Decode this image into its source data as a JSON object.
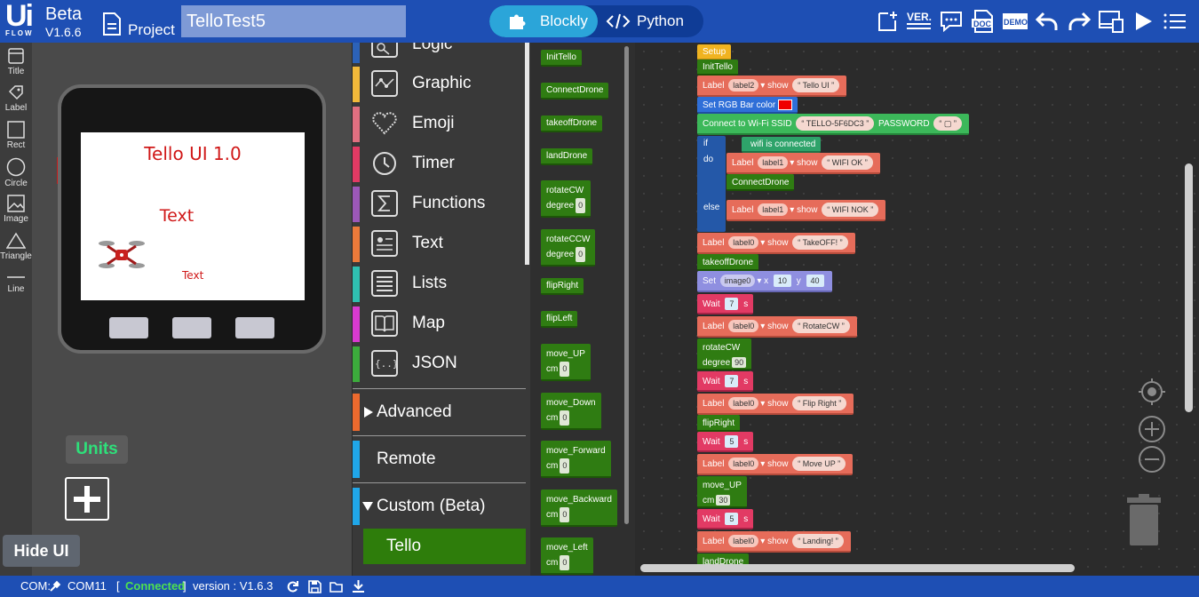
{
  "header": {
    "logo_ui": "Ui",
    "logo_flow": "FLOW",
    "beta": "Beta",
    "version": "V1.6.6",
    "project_label": "Project",
    "project_name": "TelloTest5",
    "mode_blockly": "Blockly",
    "mode_python": "Python",
    "icons": [
      "new-file-icon",
      "version-icon",
      "comment-icon",
      "doc-icon",
      "demo-icon",
      "undo-icon",
      "redo-icon",
      "device-icon",
      "run-icon",
      "menu-icon"
    ],
    "ver_text": "VER.",
    "doc_text": "DOC",
    "demo_text": "DEMO"
  },
  "tools": [
    {
      "label": "Title",
      "icon": "title-icon"
    },
    {
      "label": "Label",
      "icon": "label-icon"
    },
    {
      "label": "Rect",
      "icon": "rect-icon"
    },
    {
      "label": "Circle",
      "icon": "circle-icon"
    },
    {
      "label": "Image",
      "icon": "image-icon"
    },
    {
      "label": "Triangle",
      "icon": "triangle-icon"
    },
    {
      "label": "Line",
      "icon": "line-icon"
    }
  ],
  "device": {
    "title": "Tello UI 1.0",
    "text1": "Text",
    "text2": "Text"
  },
  "units_label": "Units",
  "hide_ui_label": "Hide UI",
  "categories": [
    {
      "label": "Logic",
      "color": "#2c62b8"
    },
    {
      "label": "Graphic",
      "color": "#f2b93a"
    },
    {
      "label": "Emoji",
      "color": "#e06f80"
    },
    {
      "label": "Timer",
      "color": "#e23a64"
    },
    {
      "label": "Functions",
      "color": "#9c58b8"
    },
    {
      "label": "Text",
      "color": "#ec7a3a"
    },
    {
      "label": "Lists",
      "color": "#2fbfb0"
    },
    {
      "label": "Map",
      "color": "#d93ad0"
    },
    {
      "label": "JSON",
      "color": "#3cac3c"
    }
  ],
  "advanced": {
    "label": "Advanced",
    "color": "#ec6a2e"
  },
  "remote": {
    "label": "Remote",
    "color": "#20a6e8"
  },
  "custom": {
    "label": "Custom (Beta)",
    "color": "#20a6e8"
  },
  "tello_item": "Tello",
  "flyout": [
    {
      "name": "InitTello"
    },
    {
      "name": "ConnectDrone"
    },
    {
      "name": "takeoffDrone"
    },
    {
      "name": "landDrone"
    },
    {
      "name": "rotateCW",
      "param": "degree",
      "val": "0"
    },
    {
      "name": "rotateCCW",
      "param": "degree",
      "val": "0"
    },
    {
      "name": "flipRight"
    },
    {
      "name": "flipLeft"
    },
    {
      "name": "move_UP",
      "param": "cm",
      "val": "0"
    },
    {
      "name": "move_Down",
      "param": "cm",
      "val": "0"
    },
    {
      "name": "move_Forward",
      "param": "cm",
      "val": "0"
    },
    {
      "name": "move_Backward",
      "param": "cm",
      "val": "0"
    },
    {
      "name": "move_Left",
      "param": "cm",
      "val": "0"
    }
  ],
  "workspace": {
    "setup": "Setup",
    "init": "InitTello",
    "label_kw": "Label",
    "show_kw": "show",
    "label2": "label2",
    "tello_ui": "Tello UI",
    "rgb": "Set RGB Bar color",
    "wifi": "Connect to Wi-Fi SSID",
    "ssid": "TELLO-5F6DC3",
    "password": "PASSWORD",
    "if_kw": "if",
    "do_kw": "do",
    "else_kw": "else",
    "wifi_connected": "wifi is connected",
    "label1": "label1",
    "wifi_ok": "WIFI OK",
    "connect_drone": "ConnectDrone",
    "wifi_nok": "WIFI NOK",
    "label0": "label0",
    "takeoff_text": "TakeOFF!",
    "takeoff": "takeoffDrone",
    "set_kw": "Set",
    "image0": "image0",
    "x_kw": "x",
    "x_val": "10",
    "y_kw": "y",
    "y_val": "40",
    "wait_kw": "Wait",
    "s_kw": "s",
    "wait1": "7",
    "rotate_text": "RotateCW",
    "rotate": "rotateCW",
    "degree_kw": "degree",
    "degree_val": "90",
    "wait2": "7",
    "flip_text": "Flip Right",
    "flip": "flipRight",
    "wait3": "5",
    "move_text": "Move UP",
    "move": "move_UP",
    "cm_kw": "cm",
    "cm_val": "30",
    "wait4": "5",
    "landing_text": "Landing!",
    "land": "landDrone"
  },
  "status": {
    "com_label": "COM:",
    "com_port": "COM11",
    "bracket_open": "[",
    "connected": "Connected",
    "bracket_close": "]",
    "version": "version : V1.6.3"
  }
}
